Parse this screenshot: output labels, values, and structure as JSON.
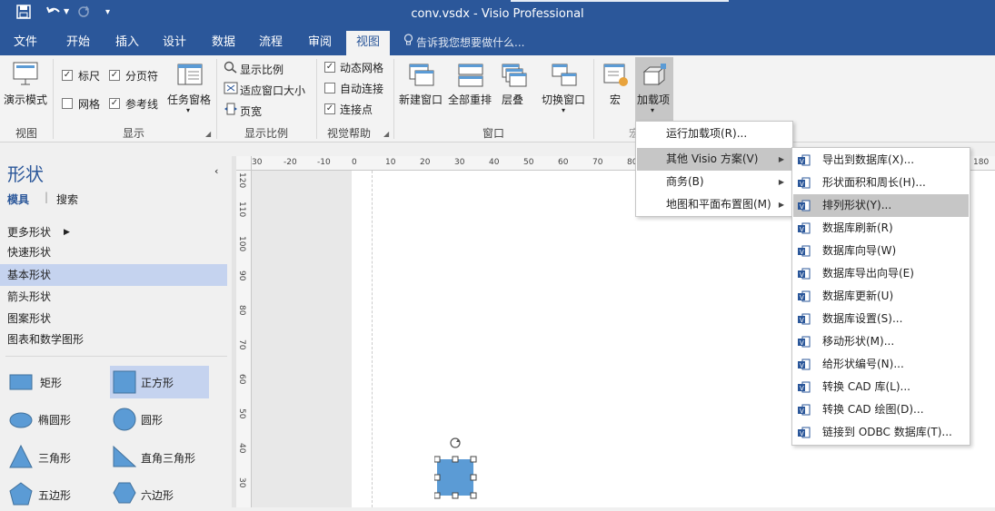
{
  "window": {
    "title": "conv.vsdx - Visio Professional"
  },
  "quick_access": {
    "save_icon": "save-icon",
    "undo_icon": "undo-icon",
    "redo_icon": "redo-icon",
    "customize_icon": "customize-icon"
  },
  "tabs": [
    "文件",
    "开始",
    "插入",
    "设计",
    "数据",
    "流程",
    "审阅",
    "视图"
  ],
  "active_tab": "视图",
  "tell_me": "告诉我您想要做什么...",
  "ribbon": {
    "view_group": {
      "present_label": "演示模式",
      "group_label": "视图"
    },
    "show_group": {
      "ruler": "标尺",
      "page_breaks": "分页符",
      "grid": "网格",
      "guides": "参考线",
      "task_panes": "任务窗格",
      "group_label": "显示"
    },
    "zoom_group": {
      "zoom": "显示比例",
      "fit_window": "适应窗口大小",
      "page_width": "页宽",
      "group_label": "显示比例"
    },
    "visual_aids_group": {
      "dynamic_grid": "动态网格",
      "auto_connect": "自动连接",
      "connection_points": "连接点",
      "group_label": "视觉帮助"
    },
    "window_group": {
      "new_window": "新建窗口",
      "arrange_all": "全部重排",
      "cascade": "层叠",
      "switch_windows": "切换窗口",
      "group_label": "窗口"
    },
    "macros_group": {
      "macros": "宏",
      "addons": "加载项",
      "group_label": "宏"
    }
  },
  "addons_menu": [
    {
      "label": "运行加载项(R)...",
      "has_sub": false
    },
    {
      "label": "其他 Visio 方案(V)",
      "has_sub": true
    },
    {
      "label": "商务(B)",
      "has_sub": true
    },
    {
      "label": "地图和平面布置图(M)",
      "has_sub": true
    }
  ],
  "addons_menu_highlight": "其他 Visio 方案(V)",
  "submenu": [
    "导出到数据库(X)...",
    "形状面积和周长(H)...",
    "排列形状(Y)...",
    "数据库刷新(R)",
    "数据库向导(W)",
    "数据库导出向导(E)",
    "数据库更新(U)",
    "数据库设置(S)...",
    "移动形状(M)...",
    "给形状编号(N)...",
    "转换 CAD 库(L)...",
    "转换 CAD 绘图(D)...",
    "链接到 ODBC 数据库(T)..."
  ],
  "submenu_highlight": "排列形状(Y)...",
  "shapes_panel": {
    "title": "形状",
    "tab_stencils": "模具",
    "tab_search": "搜索",
    "more_shapes": "更多形状",
    "stencils": [
      "快速形状",
      "基本形状",
      "箭头形状",
      "图案形状",
      "图表和数学图形"
    ],
    "selected_stencil": "基本形状",
    "shapes": [
      "矩形",
      "正方形",
      "椭圆形",
      "圆形",
      "三角形",
      "直角三角形",
      "五边形",
      "六边形"
    ],
    "selected_shape": "正方形"
  },
  "ruler_top_ticks": [
    "30",
    "-20",
    "-10",
    "0",
    "10",
    "20",
    "30",
    "40",
    "50",
    "60",
    "70",
    "80",
    "180"
  ],
  "ruler_left_ticks": [
    "120",
    "110",
    "100",
    "90",
    "80",
    "70",
    "60",
    "50",
    "40",
    "30"
  ],
  "colors": {
    "title_bar": "#2b579a",
    "shape_fill": "#5b9bd5",
    "selection": "#c5d3ef",
    "menu_highlight": "#c6c6c6"
  }
}
